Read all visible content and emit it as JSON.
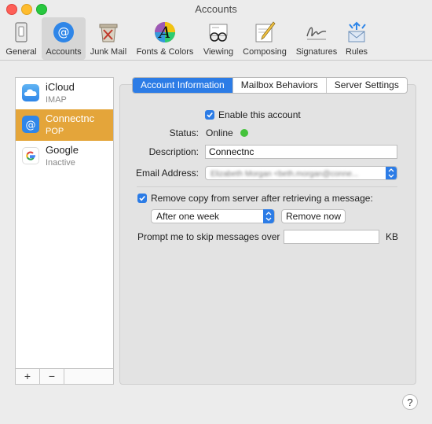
{
  "window": {
    "title": "Accounts"
  },
  "colors": {
    "accent": "#2c7ce6",
    "selection": "#e4a53a",
    "online": "#45c23c"
  },
  "toolbar": {
    "items": [
      {
        "label": "General",
        "icon": "general-icon"
      },
      {
        "label": "Accounts",
        "icon": "accounts-icon"
      },
      {
        "label": "Junk Mail",
        "icon": "junk-mail-icon"
      },
      {
        "label": "Fonts & Colors",
        "icon": "fonts-colors-icon"
      },
      {
        "label": "Viewing",
        "icon": "viewing-icon"
      },
      {
        "label": "Composing",
        "icon": "composing-icon"
      },
      {
        "label": "Signatures",
        "icon": "signatures-icon"
      },
      {
        "label": "Rules",
        "icon": "rules-icon"
      }
    ],
    "selected": "Accounts"
  },
  "sidebar": {
    "accounts": [
      {
        "name": "iCloud",
        "type": "IMAP",
        "icon": "icloud-icon"
      },
      {
        "name": "Connectnc",
        "type": "POP",
        "icon": "at-icon"
      },
      {
        "name": "Google",
        "type": "Inactive",
        "icon": "google-icon"
      }
    ],
    "add_label": "+",
    "remove_label": "−"
  },
  "tabs": [
    {
      "label": "Account Information",
      "active": true
    },
    {
      "label": "Mailbox Behaviors",
      "active": false
    },
    {
      "label": "Server Settings",
      "active": false
    }
  ],
  "form": {
    "enable_label": "Enable this account",
    "status_label": "Status:",
    "status_value": "Online",
    "description_label": "Description:",
    "description_value": "Connectnc",
    "email_label": "Email Address:",
    "email_value": "Elizabeth Morgan <beth.morgan@conne...",
    "remove_copy_label": "Remove copy from server after retrieving a message:",
    "remove_after_value": "After one week",
    "remove_now_label": "Remove now",
    "skip_label": "Prompt me to skip messages over",
    "skip_value": "",
    "skip_unit": "KB"
  },
  "help_label": "?"
}
